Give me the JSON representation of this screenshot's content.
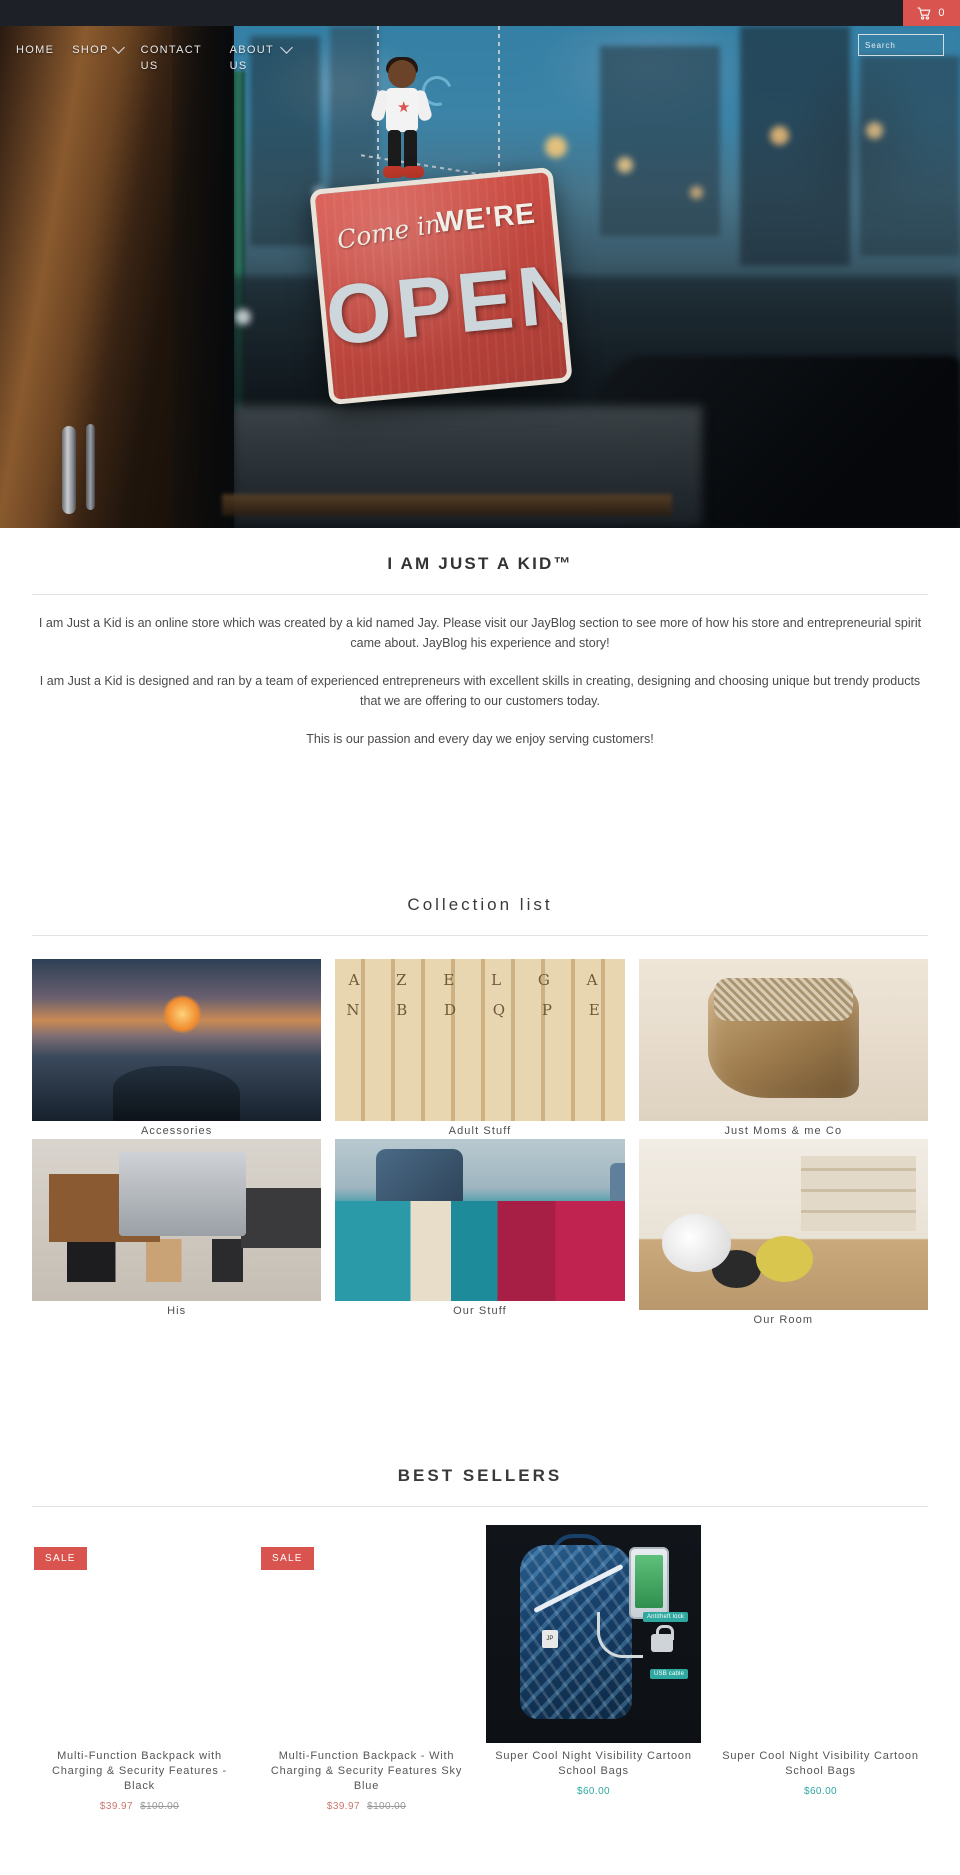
{
  "topbar": {
    "cart_icon": "shopping-cart-icon",
    "cart_count": "0",
    "accent_red": "#d9534f",
    "bar_color": "#1d2026"
  },
  "nav": {
    "items": [
      {
        "label": "HOME",
        "has_caret": false
      },
      {
        "label": "SHOP",
        "has_caret": true
      },
      {
        "label": "CONTACT US",
        "has_caret": false
      },
      {
        "label": "ABOUT US",
        "has_caret": true
      }
    ]
  },
  "search": {
    "placeholder": "Search",
    "value": "",
    "icon": "search-icon"
  },
  "hero": {
    "sign_come_in": "Come in",
    "sign_were": "WE'RE",
    "sign_open": "OPEN"
  },
  "about": {
    "title": "I AM JUST A KID™",
    "paragraph1": "I am Just a Kid is an online store which was created by a kid named Jay. Please visit our JayBlog section to see more of how his store and entrepreneurial spirit came about. JayBlog his experience and story!",
    "paragraph2": "I am Just a Kid is designed and ran by a team of experienced entrepreneurs with excellent skills in creating, designing and choosing unique but trendy products that we are offering to our customers today.",
    "paragraph3": "This is our passion and every day we enjoy serving customers!"
  },
  "collections": {
    "title": "Collection list",
    "items": [
      {
        "label": "Accessories",
        "thumb": "sunset-beach-bracelet"
      },
      {
        "label": "Adult Stuff",
        "thumb": "wooden-letter-tiles"
      },
      {
        "label": "Just Moms & me Co",
        "thumb": "gold-glitter-boots"
      },
      {
        "label": "His",
        "thumb": "mens-desk-flatlay"
      },
      {
        "label": "Our Stuff",
        "thumb": "couple-on-sofa-laptops"
      },
      {
        "label": "Our Room",
        "thumb": "kids-playroom"
      }
    ]
  },
  "best_sellers": {
    "title": "BEST SELLERS",
    "sale_label": "SALE",
    "products": [
      {
        "title": "Multi-Function Backpack with Charging & Security Features - Black",
        "price": "$39.97",
        "compare_at": "$100.00",
        "on_sale": true,
        "has_image": false
      },
      {
        "title": "Multi-Function Backpack - With Charging & Security Features Sky Blue",
        "price": "$39.97",
        "compare_at": "$100.00",
        "on_sale": true,
        "has_image": false
      },
      {
        "title": "Super Cool Night Visibility Cartoon School Bags",
        "price": "$60.00",
        "compare_at": "",
        "on_sale": false,
        "has_image": true,
        "image_labels": {
          "lock": "Antitheft lock",
          "usb": "USB cable"
        }
      },
      {
        "title": "Super Cool Night Visibility Cartoon School Bags",
        "price": "$60.00",
        "compare_at": "",
        "on_sale": false,
        "has_image": false
      }
    ]
  }
}
